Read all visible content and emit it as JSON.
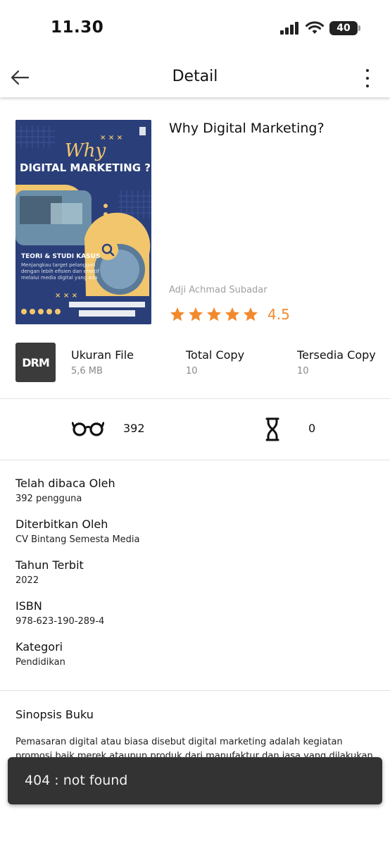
{
  "status_bar": {
    "time": "11.30",
    "battery": "40"
  },
  "header": {
    "title": "Detail",
    "back_icon": "arrow-left-icon",
    "menu_icon": "more-vertical-icon"
  },
  "book": {
    "title": "Why Digital Marketing?",
    "author": "Adji Achmad Subadar",
    "rating": "4.5",
    "rating_stars": 5,
    "cover": {
      "title_script": "Why",
      "title_main": "DIGITAL MARKETING ?",
      "subtitle": "TEORI & STUDI KASUS"
    }
  },
  "file_info": {
    "logo_text": "DRM",
    "size_label": "Ukuran File",
    "size_value": "5,6 MB",
    "total_label": "Total Copy",
    "total_value": "10",
    "available_label": "Tersedia Copy",
    "available_value": "10"
  },
  "stats": {
    "read_count": "392",
    "waiting_count": "0",
    "read_icon": "glasses-icon",
    "waiting_icon": "hourglass-icon"
  },
  "details": [
    {
      "label": "Telah dibaca Oleh",
      "value": "392 pengguna"
    },
    {
      "label": "Diterbitkan Oleh",
      "value": "CV Bintang Semesta Media"
    },
    {
      "label": "Tahun Terbit",
      "value": "2022"
    },
    {
      "label": "ISBN",
      "value": "978-623-190-289-4"
    },
    {
      "label": "Kategori",
      "value": "Pendidikan"
    }
  ],
  "synopsis": {
    "title": "Sinopsis Buku",
    "text": "Pemasaran digital atau biasa disebut digital marketing adalah kegiatan promosi baik merek ataupun produk dari manufaktur dan jasa yang dilakukan secara"
  },
  "toast": {
    "message": "404 : not found"
  },
  "colors": {
    "star": "#f28a2c",
    "cover_bg": "#2a3f7a",
    "cover_accent": "#f2c66d",
    "toast_bg": "#333333"
  }
}
